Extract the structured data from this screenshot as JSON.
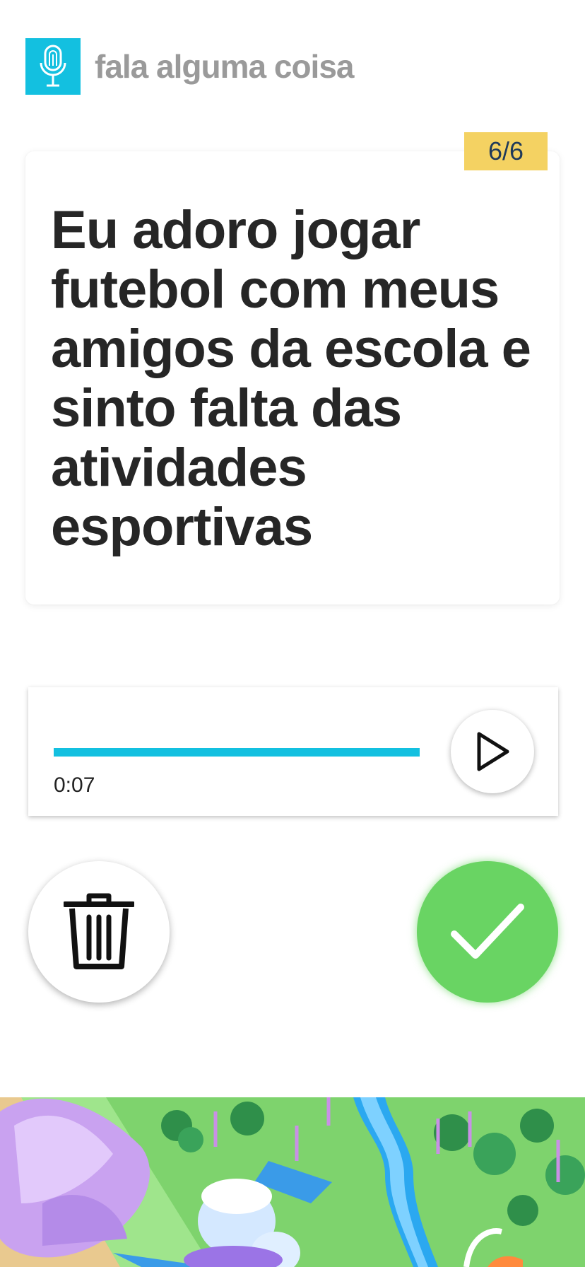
{
  "header": {
    "title": "fala alguma coisa",
    "logo_icon": "microphone-fingerprint-icon"
  },
  "card": {
    "counter": "6/6",
    "sentence": "Eu adoro jogar futebol com meus amigos da escola e sinto falta das atividades esportivas"
  },
  "player": {
    "time": "0:07",
    "progress": 1.0,
    "play_icon": "play-icon"
  },
  "actions": {
    "delete_icon": "trash-icon",
    "confirm_icon": "checkmark-icon"
  },
  "colors": {
    "accent": "#13c0e0",
    "confirm": "#69d463",
    "badge": "#f4d262",
    "title": "#9a9a9a"
  }
}
